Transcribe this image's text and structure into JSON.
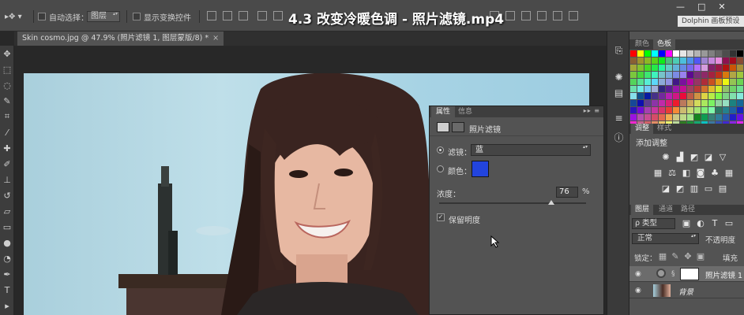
{
  "video_title": "4.3 改变冷暖色调 - 照片滤镜.mp4",
  "options_bar": {
    "auto_select_label": "自动选择：",
    "auto_select_value": "图层",
    "show_transform_label": "显示变换控件"
  },
  "right_window_tab": "Dolphin 画板预设",
  "document_tab": {
    "title": "Skin cosmo.jpg @ 47.9% (照片滤镜 1, 图层蒙版/8) *",
    "close": "×"
  },
  "properties_panel": {
    "tabs": [
      "属性",
      "信息"
    ],
    "title": "照片滤镜",
    "filter_label": "滤镜：",
    "filter_value": "蓝",
    "color_label": "颜色：",
    "color_value": "#2244dd",
    "density_label": "浓度：",
    "density_value": "76",
    "density_unit": "%",
    "preserve_luminosity_label": "保留明度",
    "preserve_luminosity_checked": true
  },
  "swatches_panel": {
    "tabs": [
      "颜色",
      "色板"
    ]
  },
  "adjustments_panel": {
    "tabs": [
      "调整",
      "样式"
    ],
    "add_adjustment_label": "添加调整"
  },
  "layers_panel": {
    "tabs": [
      "图层",
      "通道",
      "路径"
    ],
    "kind_filter": "ρ 类型",
    "blend_mode": "正常",
    "opacity_label": "不透明度",
    "lock_label": "锁定：",
    "fill_label": "填充",
    "layers": [
      {
        "name": "照片滤镜 1",
        "selected": true
      },
      {
        "name": "背景",
        "selected": false
      }
    ]
  },
  "colors": {
    "filter_color": "#2244dd",
    "panel_bg": "#535353",
    "ui_dark": "#282828"
  }
}
